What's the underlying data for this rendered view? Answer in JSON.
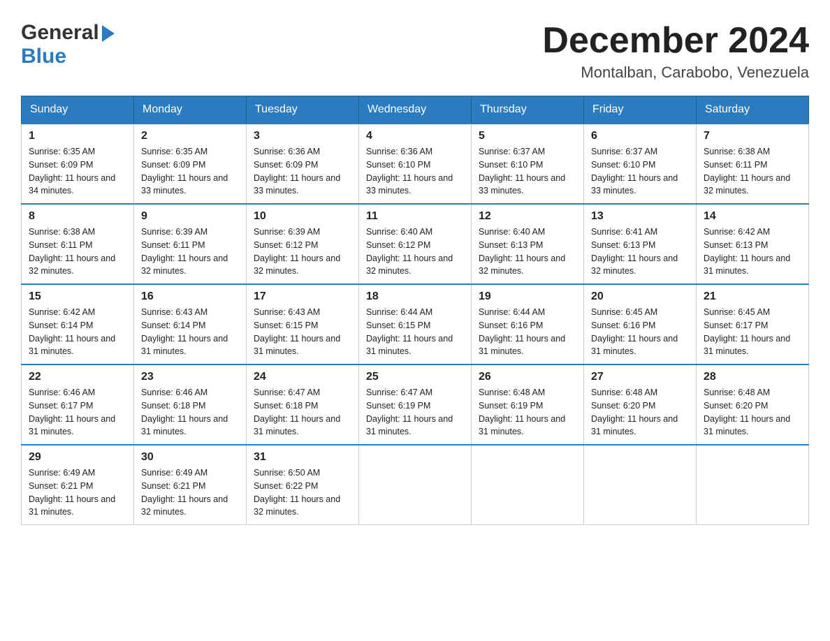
{
  "header": {
    "logo_general": "General",
    "logo_blue": "Blue",
    "month_title": "December 2024",
    "location": "Montalban, Carabobo, Venezuela"
  },
  "days_of_week": [
    "Sunday",
    "Monday",
    "Tuesday",
    "Wednesday",
    "Thursday",
    "Friday",
    "Saturday"
  ],
  "weeks": [
    [
      {
        "day": 1,
        "sunrise": "6:35 AM",
        "sunset": "6:09 PM",
        "daylight": "11 hours and 34 minutes."
      },
      {
        "day": 2,
        "sunrise": "6:35 AM",
        "sunset": "6:09 PM",
        "daylight": "11 hours and 33 minutes."
      },
      {
        "day": 3,
        "sunrise": "6:36 AM",
        "sunset": "6:09 PM",
        "daylight": "11 hours and 33 minutes."
      },
      {
        "day": 4,
        "sunrise": "6:36 AM",
        "sunset": "6:10 PM",
        "daylight": "11 hours and 33 minutes."
      },
      {
        "day": 5,
        "sunrise": "6:37 AM",
        "sunset": "6:10 PM",
        "daylight": "11 hours and 33 minutes."
      },
      {
        "day": 6,
        "sunrise": "6:37 AM",
        "sunset": "6:10 PM",
        "daylight": "11 hours and 33 minutes."
      },
      {
        "day": 7,
        "sunrise": "6:38 AM",
        "sunset": "6:11 PM",
        "daylight": "11 hours and 32 minutes."
      }
    ],
    [
      {
        "day": 8,
        "sunrise": "6:38 AM",
        "sunset": "6:11 PM",
        "daylight": "11 hours and 32 minutes."
      },
      {
        "day": 9,
        "sunrise": "6:39 AM",
        "sunset": "6:11 PM",
        "daylight": "11 hours and 32 minutes."
      },
      {
        "day": 10,
        "sunrise": "6:39 AM",
        "sunset": "6:12 PM",
        "daylight": "11 hours and 32 minutes."
      },
      {
        "day": 11,
        "sunrise": "6:40 AM",
        "sunset": "6:12 PM",
        "daylight": "11 hours and 32 minutes."
      },
      {
        "day": 12,
        "sunrise": "6:40 AM",
        "sunset": "6:13 PM",
        "daylight": "11 hours and 32 minutes."
      },
      {
        "day": 13,
        "sunrise": "6:41 AM",
        "sunset": "6:13 PM",
        "daylight": "11 hours and 32 minutes."
      },
      {
        "day": 14,
        "sunrise": "6:42 AM",
        "sunset": "6:13 PM",
        "daylight": "11 hours and 31 minutes."
      }
    ],
    [
      {
        "day": 15,
        "sunrise": "6:42 AM",
        "sunset": "6:14 PM",
        "daylight": "11 hours and 31 minutes."
      },
      {
        "day": 16,
        "sunrise": "6:43 AM",
        "sunset": "6:14 PM",
        "daylight": "11 hours and 31 minutes."
      },
      {
        "day": 17,
        "sunrise": "6:43 AM",
        "sunset": "6:15 PM",
        "daylight": "11 hours and 31 minutes."
      },
      {
        "day": 18,
        "sunrise": "6:44 AM",
        "sunset": "6:15 PM",
        "daylight": "11 hours and 31 minutes."
      },
      {
        "day": 19,
        "sunrise": "6:44 AM",
        "sunset": "6:16 PM",
        "daylight": "11 hours and 31 minutes."
      },
      {
        "day": 20,
        "sunrise": "6:45 AM",
        "sunset": "6:16 PM",
        "daylight": "11 hours and 31 minutes."
      },
      {
        "day": 21,
        "sunrise": "6:45 AM",
        "sunset": "6:17 PM",
        "daylight": "11 hours and 31 minutes."
      }
    ],
    [
      {
        "day": 22,
        "sunrise": "6:46 AM",
        "sunset": "6:17 PM",
        "daylight": "11 hours and 31 minutes."
      },
      {
        "day": 23,
        "sunrise": "6:46 AM",
        "sunset": "6:18 PM",
        "daylight": "11 hours and 31 minutes."
      },
      {
        "day": 24,
        "sunrise": "6:47 AM",
        "sunset": "6:18 PM",
        "daylight": "11 hours and 31 minutes."
      },
      {
        "day": 25,
        "sunrise": "6:47 AM",
        "sunset": "6:19 PM",
        "daylight": "11 hours and 31 minutes."
      },
      {
        "day": 26,
        "sunrise": "6:48 AM",
        "sunset": "6:19 PM",
        "daylight": "11 hours and 31 minutes."
      },
      {
        "day": 27,
        "sunrise": "6:48 AM",
        "sunset": "6:20 PM",
        "daylight": "11 hours and 31 minutes."
      },
      {
        "day": 28,
        "sunrise": "6:48 AM",
        "sunset": "6:20 PM",
        "daylight": "11 hours and 31 minutes."
      }
    ],
    [
      {
        "day": 29,
        "sunrise": "6:49 AM",
        "sunset": "6:21 PM",
        "daylight": "11 hours and 31 minutes."
      },
      {
        "day": 30,
        "sunrise": "6:49 AM",
        "sunset": "6:21 PM",
        "daylight": "11 hours and 32 minutes."
      },
      {
        "day": 31,
        "sunrise": "6:50 AM",
        "sunset": "6:22 PM",
        "daylight": "11 hours and 32 minutes."
      },
      null,
      null,
      null,
      null
    ]
  ],
  "labels": {
    "sunrise": "Sunrise:",
    "sunset": "Sunset:",
    "daylight": "Daylight:"
  }
}
